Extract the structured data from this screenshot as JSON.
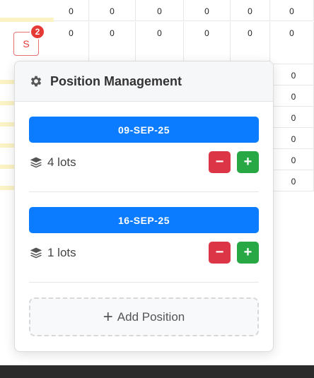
{
  "table": {
    "top_row": [
      "0",
      "0",
      "0",
      "0",
      "0",
      "0"
    ],
    "second_row": [
      "0",
      "0",
      "0",
      "0",
      "0",
      "0"
    ],
    "right_column": [
      "0",
      "0",
      "0",
      "0",
      "0",
      "0"
    ]
  },
  "user_avatar": {
    "initial": "S",
    "badge_count": "2"
  },
  "popover": {
    "title": "Position Management",
    "positions": [
      {
        "date": "09-SEP-25",
        "lots": "4 lots",
        "minus_label": "−",
        "plus_label": "+"
      },
      {
        "date": "16-SEP-25",
        "lots": "1 lots",
        "minus_label": "−",
        "plus_label": "+"
      }
    ],
    "add_label": "Add Position",
    "add_glyph": "+"
  },
  "colors": {
    "accent": "#0b7cff",
    "danger": "#dc3545",
    "success": "#28a745",
    "badge": "#e53935"
  }
}
